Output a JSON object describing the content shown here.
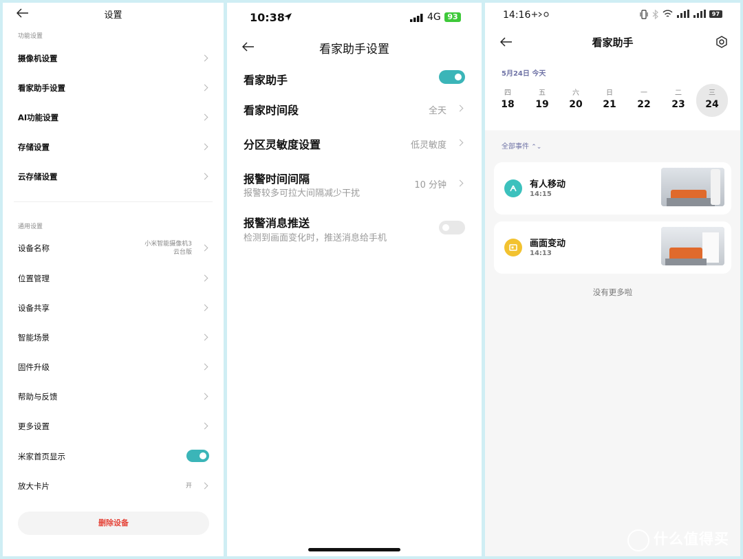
{
  "panel1": {
    "title": "设置",
    "section1": "功能设置",
    "feature_items": [
      {
        "label": "摄像机设置"
      },
      {
        "label": "看家助手设置"
      },
      {
        "label": "AI功能设置"
      },
      {
        "label": "存储设置"
      },
      {
        "label": "云存储设置"
      }
    ],
    "section2": "通用设置",
    "general_items": [
      {
        "label": "设备名称",
        "value_line1": "小米智能摄像机3",
        "value_line2": "云台版"
      },
      {
        "label": "位置管理"
      },
      {
        "label": "设备共享"
      },
      {
        "label": "智能场景"
      },
      {
        "label": "固件升级"
      },
      {
        "label": "帮助与反馈"
      },
      {
        "label": "更多设置"
      },
      {
        "label": "米家首页显示",
        "toggle": true
      },
      {
        "label": "放大卡片",
        "value": "开"
      }
    ],
    "delete_label": "删除设备"
  },
  "panel2": {
    "time": "10:38",
    "network": "4G",
    "battery": "93",
    "title": "看家助手设置",
    "rows": [
      {
        "label": "看家助手",
        "toggle": true
      },
      {
        "label": "看家时间段",
        "value": "全天"
      },
      {
        "label": "分区灵敏度设置",
        "value": "低灵敏度"
      },
      {
        "label": "报警时间间隔",
        "sub": "报警较多可拉大间隔减少干扰",
        "value": "10 分钟"
      },
      {
        "label": "报警消息推送",
        "sub": "检测到画面变化时，推送消息给手机",
        "toggle": false
      }
    ]
  },
  "panel3": {
    "time": "14:16",
    "battery": "97",
    "title": "看家助手",
    "date_label": "5月24日 今天",
    "days": [
      {
        "wd": "四",
        "dn": "18"
      },
      {
        "wd": "五",
        "dn": "19"
      },
      {
        "wd": "六",
        "dn": "20"
      },
      {
        "wd": "日",
        "dn": "21"
      },
      {
        "wd": "一",
        "dn": "22"
      },
      {
        "wd": "二",
        "dn": "23"
      },
      {
        "wd": "三",
        "dn": "24",
        "selected": true
      }
    ],
    "filter_label": "全部事件",
    "events": [
      {
        "name": "有人移动",
        "time": "14:15",
        "icon": "person-icon",
        "color": "#3cc1bd"
      },
      {
        "name": "画面变动",
        "time": "14:13",
        "icon": "screen-change-icon",
        "color": "#f2c230"
      }
    ],
    "no_more": "没有更多啦"
  },
  "watermark": "什么值得买",
  "colors": {
    "toggle_on": "#3bb5b8",
    "toggle_off": "#e8e8e8",
    "danger": "#e5453a",
    "accent_text": "#6f73a6"
  }
}
